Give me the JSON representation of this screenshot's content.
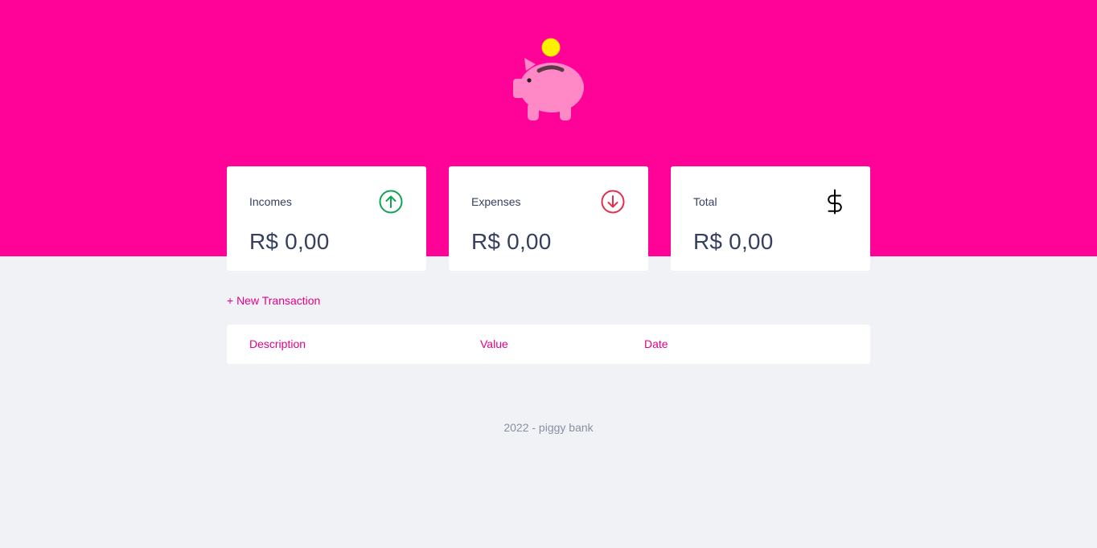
{
  "colors": {
    "header_bg": "#ff0399",
    "page_bg": "#f0f2f5",
    "accent_text": "#e5008a",
    "income_icon": "#12a454",
    "expense_icon": "#e52e4d",
    "total_icon": "#000000",
    "piggy": "#ff88c6",
    "coin": "#fff000"
  },
  "header": {
    "logo_icon": "piggy-bank-coin-icon"
  },
  "summary": {
    "incomes": {
      "label": "Incomes",
      "value": "R$ 0,00",
      "icon": "arrow-up-circle-icon"
    },
    "expenses": {
      "label": "Expenses",
      "value": "R$ 0,00",
      "icon": "arrow-down-circle-icon"
    },
    "total": {
      "label": "Total",
      "value": "R$ 0,00",
      "icon": "dollar-sign-icon"
    }
  },
  "actions": {
    "new_transaction": "+ New Transaction"
  },
  "table": {
    "columns": [
      "Description",
      "Value",
      "Date"
    ],
    "rows": []
  },
  "footer": {
    "text": "2022 - piggy bank"
  }
}
